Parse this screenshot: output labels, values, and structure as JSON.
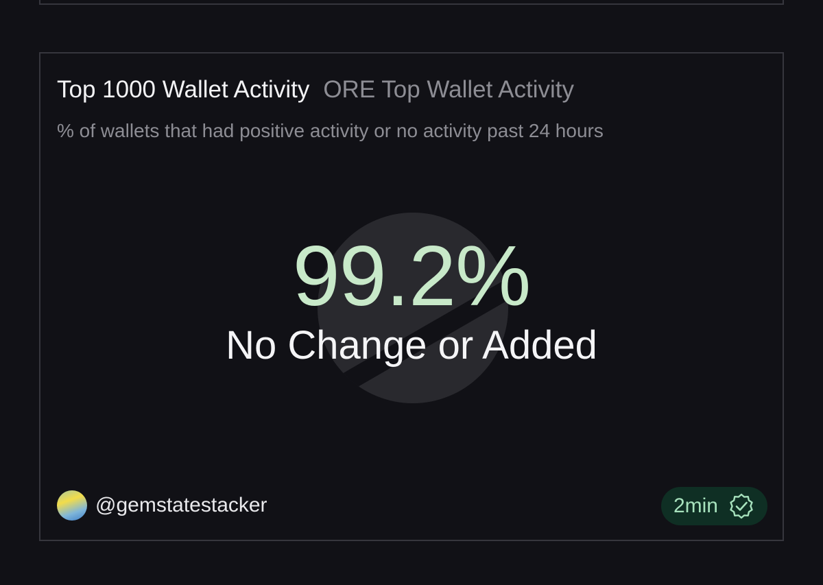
{
  "card": {
    "title": "Top 1000 Wallet Activity",
    "source": "ORE Top Wallet Activity",
    "description": "% of wallets that had positive activity or no activity past 24 hours",
    "metric": {
      "value": "99.2%",
      "label": "No Change or Added"
    },
    "author": {
      "username": "@gemstatestacker"
    },
    "freshness": {
      "label": "2min",
      "icon": "verified-check-icon"
    }
  },
  "colors": {
    "background": "#111116",
    "border": "#36363d",
    "metric_value": "#c8e9c9",
    "badge_background": "#0f2f24",
    "badge_text": "#a7e2bd",
    "muted_text": "#8d8d94"
  }
}
